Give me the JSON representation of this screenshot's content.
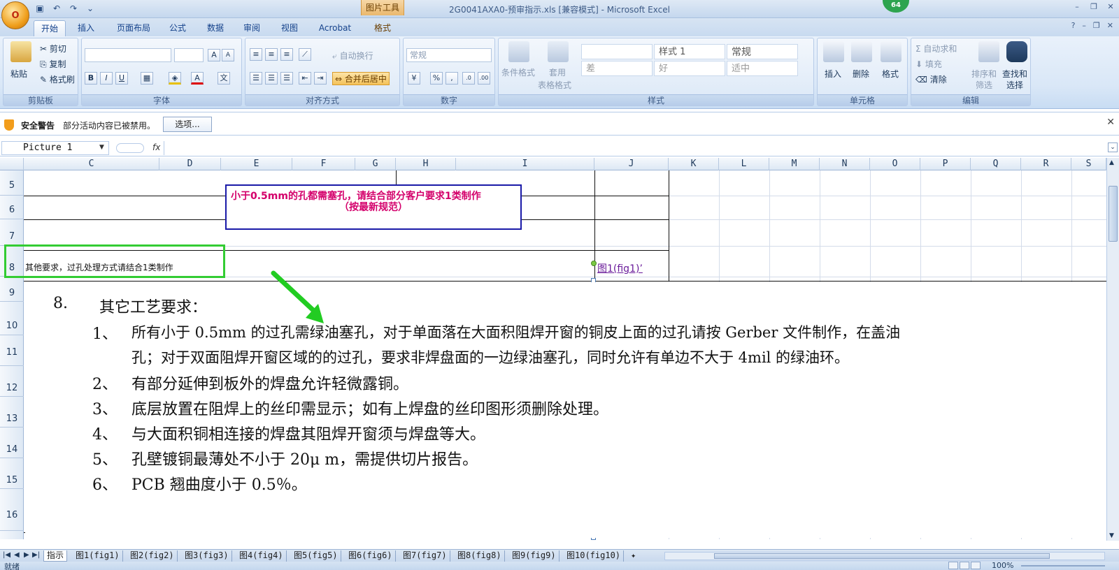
{
  "window": {
    "title": "2G0041AXA0-预审指示.xls  [兼容模式] - Microsoft Excel",
    "context_tab": "图片工具",
    "badge": "64",
    "office_button": "O"
  },
  "ribbon_tabs": [
    "开始",
    "插入",
    "页面布局",
    "公式",
    "数据",
    "审阅",
    "视图",
    "Acrobat",
    "格式"
  ],
  "ribbon": {
    "clipboard": {
      "label": "剪贴板",
      "paste": "粘贴",
      "cut": "剪切",
      "copy": "复制",
      "format_painter": "格式刷"
    },
    "font": {
      "label": "字体",
      "bold": "B",
      "italic": "I",
      "underline": "U",
      "grow": "A",
      "shrink": "A"
    },
    "alignment": {
      "label": "对齐方式",
      "wrap": "自动换行",
      "merge": "合并后居中"
    },
    "number": {
      "label": "数字",
      "format": "常规",
      "percent": "%",
      "comma": ","
    },
    "styles": {
      "label": "样式",
      "conditional": "条件格式",
      "table": "套用",
      "table2": "表格格式",
      "style1": "样式 1",
      "normal": "常规",
      "bad": "差",
      "good": "好",
      "neutral": "适中"
    },
    "cells": {
      "label": "单元格",
      "insert": "插入",
      "delete": "删除",
      "format": "格式"
    },
    "editing": {
      "label": "编辑",
      "autosum": "自动求和",
      "fill": "填充",
      "clear": "清除",
      "sort": "排序和",
      "sort2": "筛选",
      "find": "查找和",
      "find2": "选择"
    }
  },
  "security": {
    "title": "安全警告",
    "message": "部分活动内容已被禁用。",
    "button": "选项..."
  },
  "formula_bar": {
    "name_box": "Picture 1",
    "fx": "fx"
  },
  "columns": [
    "C",
    "D",
    "E",
    "F",
    "G",
    "H",
    "I",
    "J",
    "K",
    "L",
    "M",
    "N",
    "O",
    "P",
    "Q",
    "R",
    "S"
  ],
  "rows": [
    "5",
    "6",
    "7",
    "8",
    "9",
    "10",
    "11",
    "12",
    "13",
    "14",
    "15",
    "16"
  ],
  "cells": {
    "note_line1": "小于0.5mm的孔都需塞孔，请结合部分客户要求1类制作",
    "note_line2": "（按最新规范）",
    "other_requirements": "其他要求，过孔处理方式请结合1类制作",
    "fig_link": "图1(fig1)’"
  },
  "picture": {
    "heading_num": "8.",
    "heading": "其它工艺要求：",
    "items": [
      {
        "num": "1、",
        "text": "所有小于 0.5mm 的过孔需绿油塞孔，对于单面落在大面积阻焊开窗的铜皮上面的过孔请按 Gerber 文件制作，在盖油"
      },
      {
        "num": "",
        "text": "孔；对于双面阻焊开窗区域的的过孔，要求非焊盘面的一边绿油塞孔，同时允许有单边不大于 4mil 的绿油环。"
      },
      {
        "num": "2、",
        "text": "有部分延伸到板外的焊盘允许轻微露铜。"
      },
      {
        "num": "3、",
        "text": "底层放置在阻焊上的丝印需显示；如有上焊盘的丝印图形须删除处理。"
      },
      {
        "num": "4、",
        "text": "与大面积铜相连接的焊盘其阻焊开窗须与焊盘等大。"
      },
      {
        "num": "5、",
        "text": "孔壁镀铜最薄处不小于 20μ m，需提供切片报告。"
      },
      {
        "num": "6、",
        "text": "PCB 翘曲度小于 0.5％。"
      }
    ]
  },
  "sheet_tabs": [
    "指示",
    "图1(fig1)",
    "图2(fig2)",
    "图3(fig3)",
    "图4(fig4)",
    "图5(fig5)",
    "图6(fig6)",
    "图7(fig7)",
    "图8(fig8)",
    "图9(fig9)",
    "图10(fig10)"
  ],
  "status": {
    "text": "就绪",
    "zoom": "100%"
  },
  "colors": {
    "accent": "#d4006b",
    "note_border": "#1a1aa8",
    "highlight_box": "#33cc33",
    "arrow": "#22cc22"
  }
}
